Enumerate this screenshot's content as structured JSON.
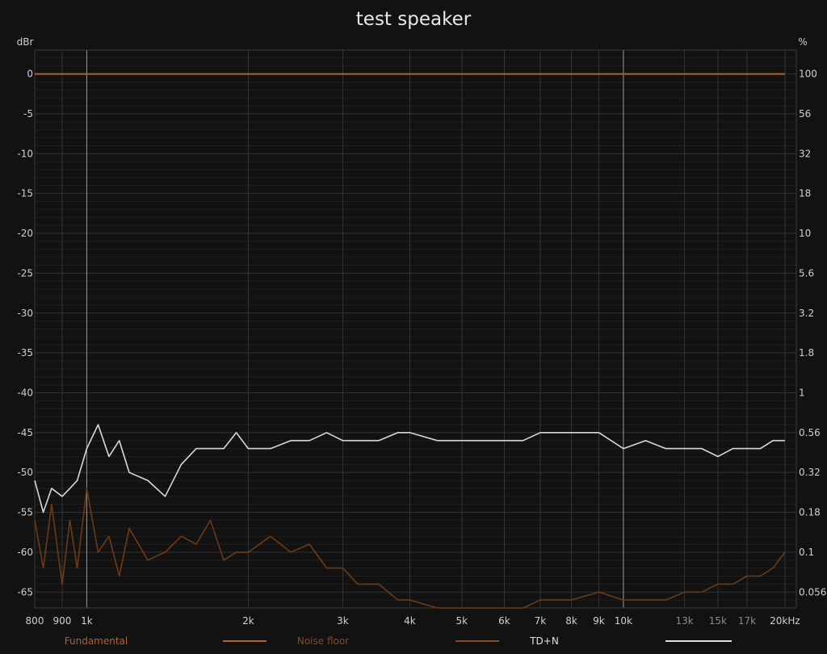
{
  "chart_data": {
    "type": "line",
    "title": "test speaker",
    "left_unit": "dBr",
    "right_unit": "%",
    "x_scale": "log",
    "x_unit": "kHz",
    "xlim": [
      800,
      21000
    ],
    "ylim": [
      -67,
      3
    ],
    "grid": true,
    "x_ticks": [
      {
        "value": 800,
        "label": "800",
        "dim": false
      },
      {
        "value": 900,
        "label": "900",
        "dim": false
      },
      {
        "value": 1000,
        "label": "1k",
        "dim": false
      },
      {
        "value": 2000,
        "label": "2k",
        "dim": false
      },
      {
        "value": 3000,
        "label": "3k",
        "dim": false
      },
      {
        "value": 4000,
        "label": "4k",
        "dim": false
      },
      {
        "value": 5000,
        "label": "5k",
        "dim": false
      },
      {
        "value": 6000,
        "label": "6k",
        "dim": false
      },
      {
        "value": 7000,
        "label": "7k",
        "dim": false
      },
      {
        "value": 8000,
        "label": "8k",
        "dim": false
      },
      {
        "value": 9000,
        "label": "9k",
        "dim": false
      },
      {
        "value": 10000,
        "label": "10k",
        "dim": false
      },
      {
        "value": 13000,
        "label": "13k",
        "dim": true
      },
      {
        "value": 15000,
        "label": "15k",
        "dim": true
      },
      {
        "value": 17000,
        "label": "17k",
        "dim": true
      },
      {
        "value": 20000,
        "label": "20kHz",
        "dim": false
      }
    ],
    "y_ticks_left": [
      {
        "value": 0,
        "label": "0"
      },
      {
        "value": -5,
        "label": "-5"
      },
      {
        "value": -10,
        "label": "-10"
      },
      {
        "value": -15,
        "label": "-15"
      },
      {
        "value": -20,
        "label": "-20"
      },
      {
        "value": -25,
        "label": "-25"
      },
      {
        "value": -30,
        "label": "-30"
      },
      {
        "value": -35,
        "label": "-35"
      },
      {
        "value": -40,
        "label": "-40"
      },
      {
        "value": -45,
        "label": "-45"
      },
      {
        "value": -50,
        "label": "-50"
      },
      {
        "value": -55,
        "label": "-55"
      },
      {
        "value": -60,
        "label": "-60"
      },
      {
        "value": -65,
        "label": "-65"
      }
    ],
    "y_ticks_right": [
      {
        "value": 0,
        "label": "100"
      },
      {
        "value": -5,
        "label": "56"
      },
      {
        "value": -10,
        "label": "32"
      },
      {
        "value": -15,
        "label": "18"
      },
      {
        "value": -20,
        "label": "10"
      },
      {
        "value": -25,
        "label": "5.6"
      },
      {
        "value": -30,
        "label": "3.2"
      },
      {
        "value": -35,
        "label": "1.8"
      },
      {
        "value": -40,
        "label": "1"
      },
      {
        "value": -45,
        "label": "0.56"
      },
      {
        "value": -50,
        "label": "0.32"
      },
      {
        "value": -55,
        "label": "0.18"
      },
      {
        "value": -60,
        "label": "0.1"
      },
      {
        "value": -65,
        "label": "0.056"
      }
    ],
    "series": [
      {
        "name": "Fundamental",
        "color": "#b5612a",
        "x": [
          800,
          20000
        ],
        "y": [
          0,
          0
        ]
      },
      {
        "name": "Noise floor",
        "color": "#6e3a16",
        "x": [
          800,
          830,
          860,
          900,
          930,
          960,
          1000,
          1050,
          1100,
          1150,
          1200,
          1300,
          1400,
          1500,
          1600,
          1700,
          1800,
          1900,
          2000,
          2200,
          2400,
          2600,
          2800,
          3000,
          3200,
          3500,
          3800,
          4000,
          4500,
          5000,
          5500,
          6000,
          6500,
          7000,
          7500,
          8000,
          9000,
          10000,
          11000,
          12000,
          13000,
          14000,
          15000,
          16000,
          17000,
          18000,
          19000,
          20000
        ],
        "y": [
          -56,
          -62,
          -54,
          -64,
          -56,
          -62,
          -52,
          -60,
          -58,
          -63,
          -57,
          -61,
          -60,
          -58,
          -59,
          -56,
          -61,
          -60,
          -60,
          -58,
          -60,
          -59,
          -62,
          -62,
          -64,
          -64,
          -66,
          -66,
          -67,
          -67,
          -67,
          -67,
          -67,
          -66,
          -66,
          -66,
          -65,
          -66,
          -66,
          -66,
          -65,
          -65,
          -64,
          -64,
          -63,
          -63,
          -62,
          -60
        ]
      },
      {
        "name": "TD+N",
        "color": "#d8d8d8",
        "x": [
          800,
          830,
          860,
          900,
          930,
          960,
          1000,
          1050,
          1100,
          1150,
          1200,
          1300,
          1400,
          1500,
          1600,
          1700,
          1800,
          1900,
          2000,
          2200,
          2400,
          2600,
          2800,
          3000,
          3200,
          3500,
          3800,
          4000,
          4500,
          5000,
          5500,
          6000,
          6500,
          7000,
          7500,
          8000,
          9000,
          10000,
          11000,
          12000,
          13000,
          14000,
          15000,
          16000,
          17000,
          18000,
          19000,
          20000
        ],
        "y": [
          -51,
          -55,
          -52,
          -53,
          -52,
          -51,
          -47,
          -44,
          -48,
          -46,
          -50,
          -51,
          -53,
          -49,
          -47,
          -47,
          -47,
          -45,
          -47,
          -47,
          -46,
          -46,
          -45,
          -46,
          -46,
          -46,
          -45,
          -45,
          -46,
          -46,
          -46,
          -46,
          -46,
          -45,
          -45,
          -45,
          -45,
          -47,
          -46,
          -47,
          -47,
          -47,
          -48,
          -47,
          -47,
          -47,
          -46,
          -46
        ]
      }
    ],
    "legend": [
      {
        "label": "Fundamental",
        "color": "#b5612a"
      },
      {
        "label": "Noise floor",
        "color": "#8a4a22"
      },
      {
        "label": "TD+N",
        "color": "#e0e0e0"
      }
    ]
  }
}
